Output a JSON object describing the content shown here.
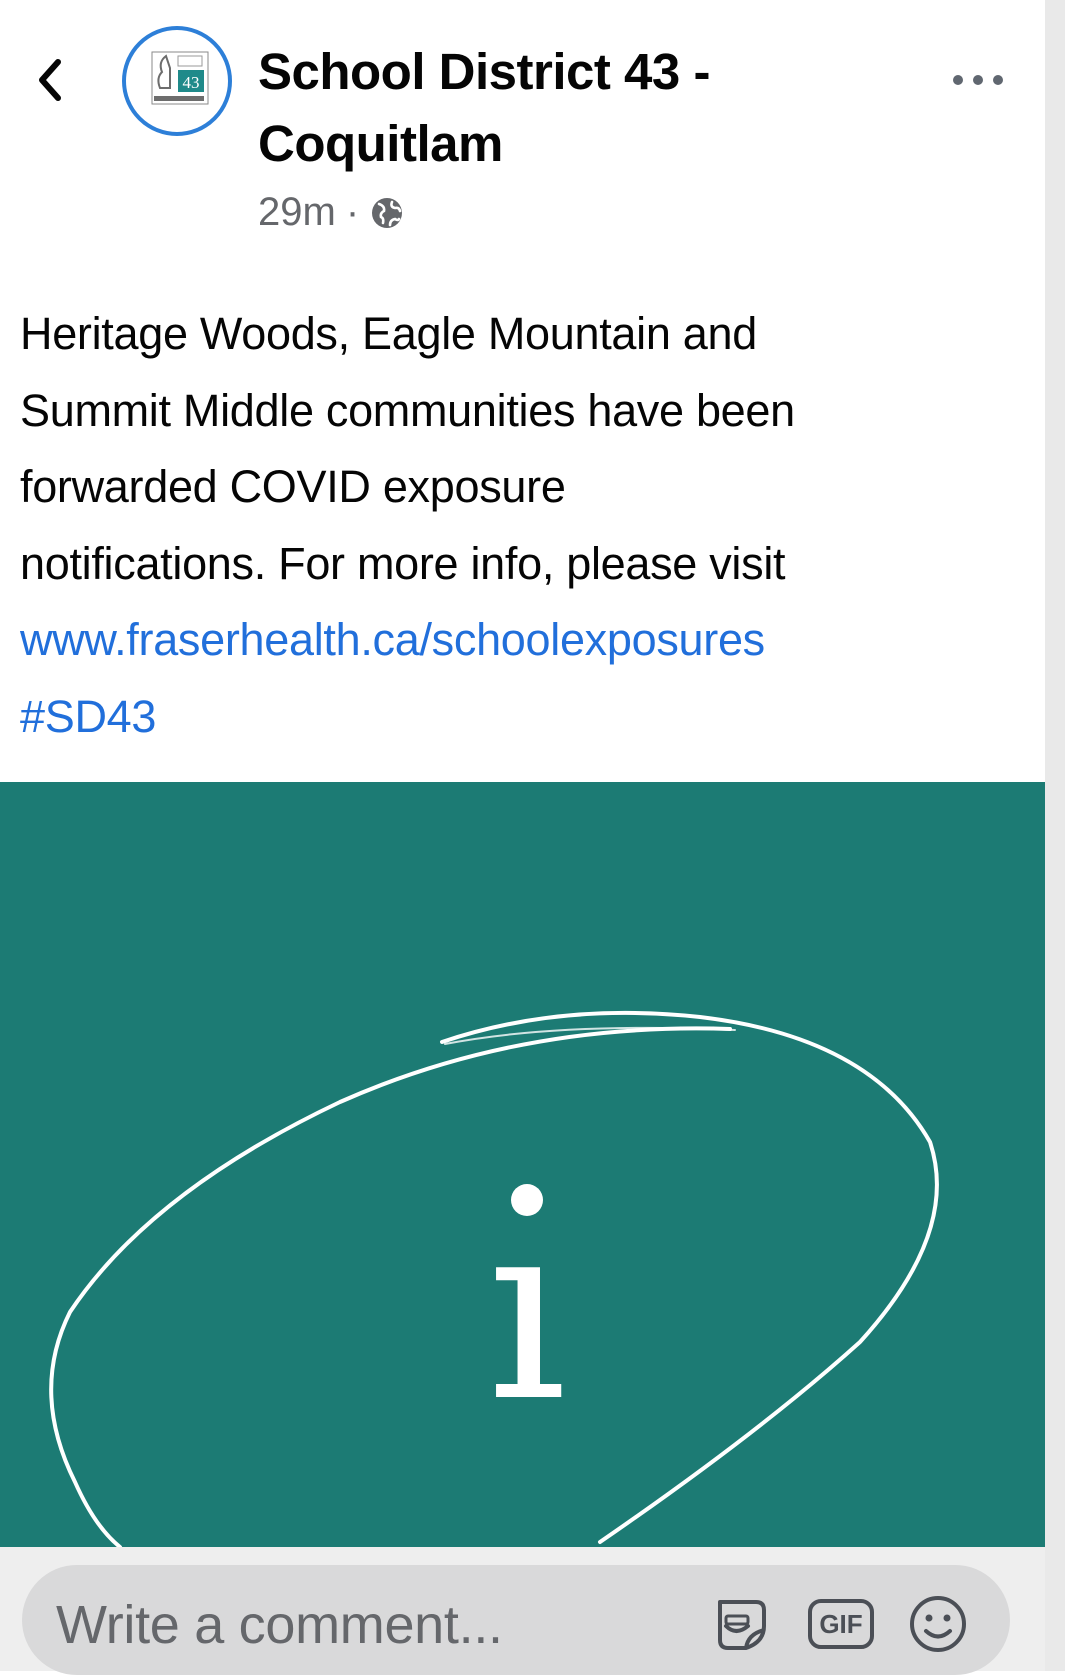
{
  "header": {
    "page_name_line1": "School District 43 -",
    "page_name_line2": "Coquitlam",
    "time": "29m",
    "separator": "·",
    "avatar_logo_text": "43"
  },
  "post": {
    "lines": [
      "Heritage Woods, Eagle Mountain and",
      "Summit Middle communities have been",
      "forwarded COVID exposure",
      "notifications. For more info, please visit"
    ],
    "link": "www.fraserhealth.ca/schoolexposures",
    "hashtag": "#SD43",
    "image_glyph": "i"
  },
  "comment": {
    "placeholder": "Write a comment...",
    "gif_label": "GIF"
  },
  "colors": {
    "link": "#216fdb",
    "image_bg": "#1c7b74",
    "avatar_ring": "#2d7fd8"
  }
}
